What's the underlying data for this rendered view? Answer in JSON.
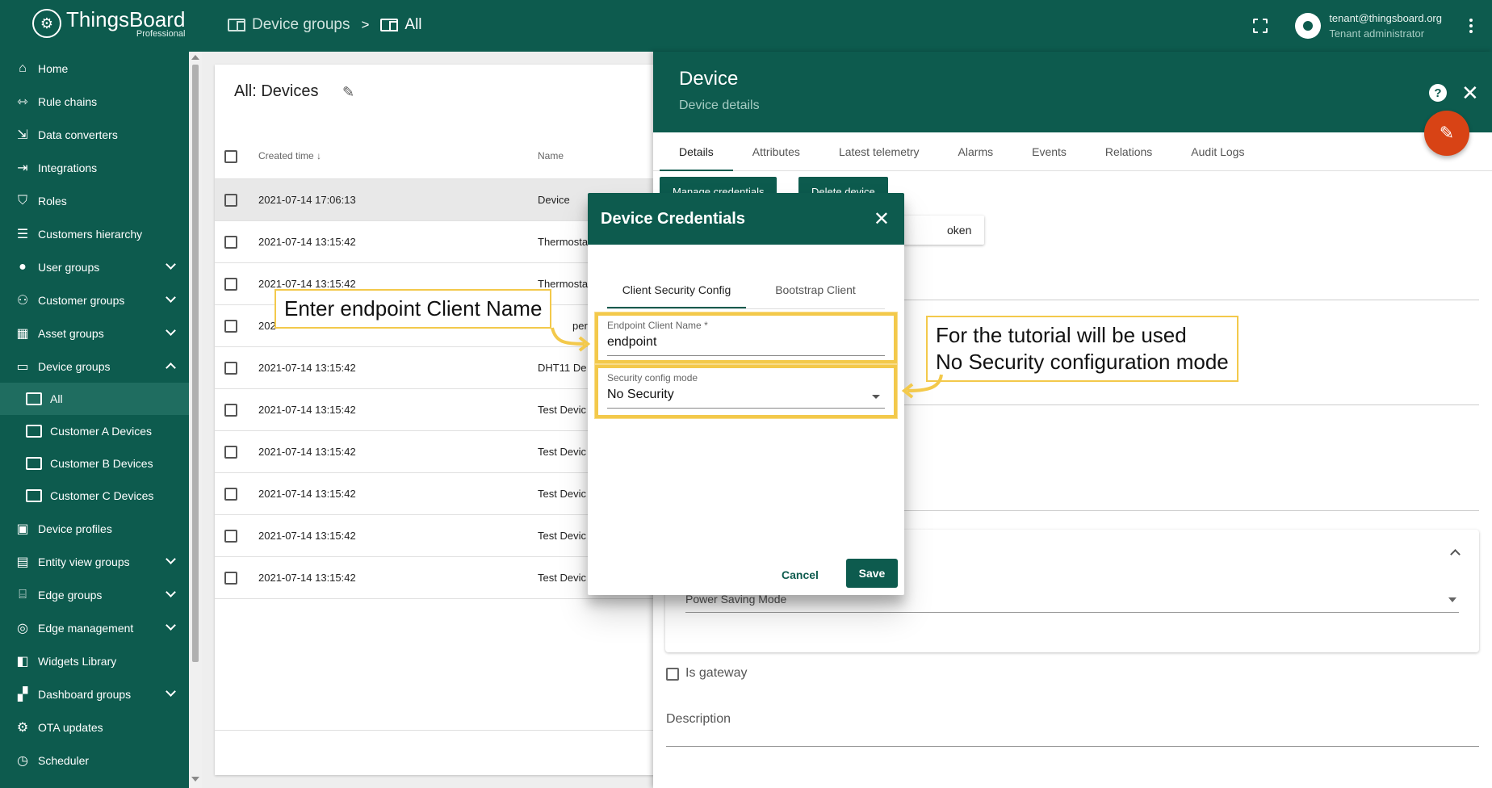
{
  "topbar": {
    "logo_title": "ThingsBoard",
    "logo_sub": "Professional",
    "breadcrumb": [
      "Device groups",
      "All"
    ],
    "breadcrumb_sep": ">",
    "user_email": "tenant@thingsboard.org",
    "user_role": "Tenant administrator"
  },
  "sidebar": {
    "items": [
      {
        "label": "Home",
        "icon": "home-icon"
      },
      {
        "label": "Rule chains",
        "icon": "rule-chains-icon"
      },
      {
        "label": "Data converters",
        "icon": "data-converters-icon"
      },
      {
        "label": "Integrations",
        "icon": "integrations-icon"
      },
      {
        "label": "Roles",
        "icon": "roles-icon"
      },
      {
        "label": "Customers hierarchy",
        "icon": "hierarchy-icon"
      },
      {
        "label": "User groups",
        "icon": "user-groups-icon"
      },
      {
        "label": "Customer groups",
        "icon": "customer-groups-icon"
      },
      {
        "label": "Asset groups",
        "icon": "asset-groups-icon"
      },
      {
        "label": "Device groups",
        "icon": "device-groups-icon"
      },
      {
        "label": "All"
      },
      {
        "label": "Customer A Devices"
      },
      {
        "label": "Customer B Devices"
      },
      {
        "label": "Customer C Devices"
      },
      {
        "label": "Device profiles",
        "icon": "device-profiles-icon"
      },
      {
        "label": "Entity view groups",
        "icon": "entity-view-icon"
      },
      {
        "label": "Edge groups",
        "icon": "edge-groups-icon"
      },
      {
        "label": "Edge management",
        "icon": "edge-management-icon"
      },
      {
        "label": "Widgets Library",
        "icon": "widgets-icon"
      },
      {
        "label": "Dashboard groups",
        "icon": "dashboard-icon"
      },
      {
        "label": "OTA updates",
        "icon": "ota-icon"
      },
      {
        "label": "Scheduler",
        "icon": "scheduler-icon"
      }
    ]
  },
  "table": {
    "title": "All: Devices",
    "col_time": "Created time",
    "col_name": "Name",
    "rows": [
      {
        "time": "2021-07-14 17:06:13",
        "name": "Device"
      },
      {
        "time": "2021-07-14 13:15:42",
        "name": "Thermosta"
      },
      {
        "time": "2021-07-14 13:15:42",
        "name": "Thermosta"
      },
      {
        "time": "202",
        "name": "perry"
      },
      {
        "time": "2021-07-14 13:15:42",
        "name": "DHT11 De"
      },
      {
        "time": "2021-07-14 13:15:42",
        "name": "Test Devic"
      },
      {
        "time": "2021-07-14 13:15:42",
        "name": "Test Devic"
      },
      {
        "time": "2021-07-14 13:15:42",
        "name": "Test Devic"
      },
      {
        "time": "2021-07-14 13:15:42",
        "name": "Test Devic"
      },
      {
        "time": "2021-07-14 13:15:42",
        "name": "Test Devic"
      }
    ]
  },
  "panel": {
    "title": "Device",
    "subtitle": "Device details",
    "tabs": [
      "Details",
      "Attributes",
      "Latest telemetry",
      "Alarms",
      "Events",
      "Relations",
      "Audit Logs"
    ],
    "manage_credentials": "Manage credentials",
    "delete_device": "Delete device",
    "copy_token_partial": "oken",
    "power_saving": "Power Saving Mode",
    "is_gateway": "Is gateway",
    "description": "Description"
  },
  "dialog": {
    "title": "Device Credentials",
    "tabs": [
      "Client Security Config",
      "Bootstrap Client"
    ],
    "endpoint_label": "Endpoint Client Name *",
    "endpoint_value": "endpoint",
    "security_label": "Security config mode",
    "security_value": "No Security",
    "cancel": "Cancel",
    "save": "Save"
  },
  "callouts": {
    "left": "Enter endpoint Client Name",
    "right_line1": "For the tutorial will be used",
    "right_line2": "No Security configuration mode"
  },
  "colors": {
    "primary": "#0d5b4e",
    "fab": "#d84315",
    "highlight": "#f3c94b"
  }
}
